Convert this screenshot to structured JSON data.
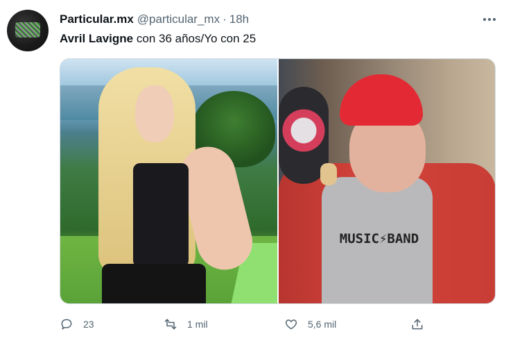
{
  "tweet": {
    "author_name": "Particular.mx",
    "handle": "@particular_mx",
    "separator": "·",
    "time": "18h",
    "text_highlight": "Avril Lavigne",
    "text_rest": " con 36 años/Yo con 25",
    "media": {
      "shirt_print": "MUSIC⚡BAND"
    },
    "actions": {
      "reply_count": "23",
      "retweet_count": "1 mil",
      "like_count": "5,6 mil"
    }
  },
  "icons": {
    "more": "more-horizontal-icon",
    "reply": "reply-icon",
    "retweet": "retweet-icon",
    "like": "heart-icon",
    "share": "share-icon"
  },
  "colors": {
    "text_primary": "#0f1419",
    "text_secondary": "#536471",
    "border": "#cfd9de"
  }
}
